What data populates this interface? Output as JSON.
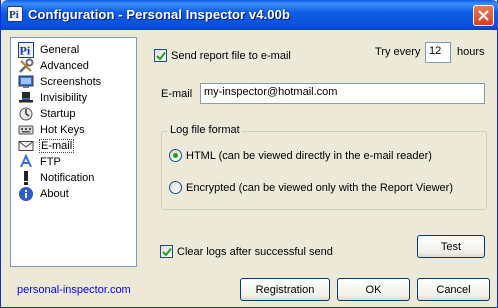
{
  "window": {
    "title": "Configuration - Personal Inspector v4.00b",
    "icon": "pi-app-icon",
    "close_icon": "close-icon"
  },
  "sidebar": {
    "selected": "E-mail",
    "items": [
      {
        "label": "General",
        "icon": "pi-icon"
      },
      {
        "label": "Advanced",
        "icon": "tools-icon"
      },
      {
        "label": "Screenshots",
        "icon": "monitor-icon"
      },
      {
        "label": "Invisibility",
        "icon": "hat-icon"
      },
      {
        "label": "Startup",
        "icon": "startup-icon"
      },
      {
        "label": "Hot Keys",
        "icon": "keyboard-icon"
      },
      {
        "label": "E-mail",
        "icon": "envelope-icon"
      },
      {
        "label": "FTP",
        "icon": "ftp-icon"
      },
      {
        "label": "Notification",
        "icon": "exclamation-icon"
      },
      {
        "label": "About",
        "icon": "info-icon"
      }
    ]
  },
  "email": {
    "send_report_label": "Send report file to e-mail",
    "send_report_checked": true,
    "try_every_label": "Try every",
    "try_every_value": "12",
    "hours_label": "hours",
    "email_label": "E-mail",
    "email_value": "my-inspector@hotmail.com",
    "log_format_legend": "Log file format",
    "format_options": [
      {
        "label": "HTML (can be viewed directly in the e-mail reader)",
        "selected": true
      },
      {
        "label": "Encrypted (can be viewed only with the Report Viewer)",
        "selected": false
      }
    ],
    "clear_logs_label": "Clear logs after successful send",
    "clear_logs_checked": true,
    "test_button": "Test"
  },
  "footer": {
    "link": "personal-inspector.com",
    "registration_button": "Registration",
    "ok_button": "OK",
    "cancel_button": "Cancel"
  },
  "colors": {
    "titlebar": "#0b55e0",
    "link": "#0000ff",
    "check": "#21a121",
    "window_bg": "#ece9d8"
  }
}
